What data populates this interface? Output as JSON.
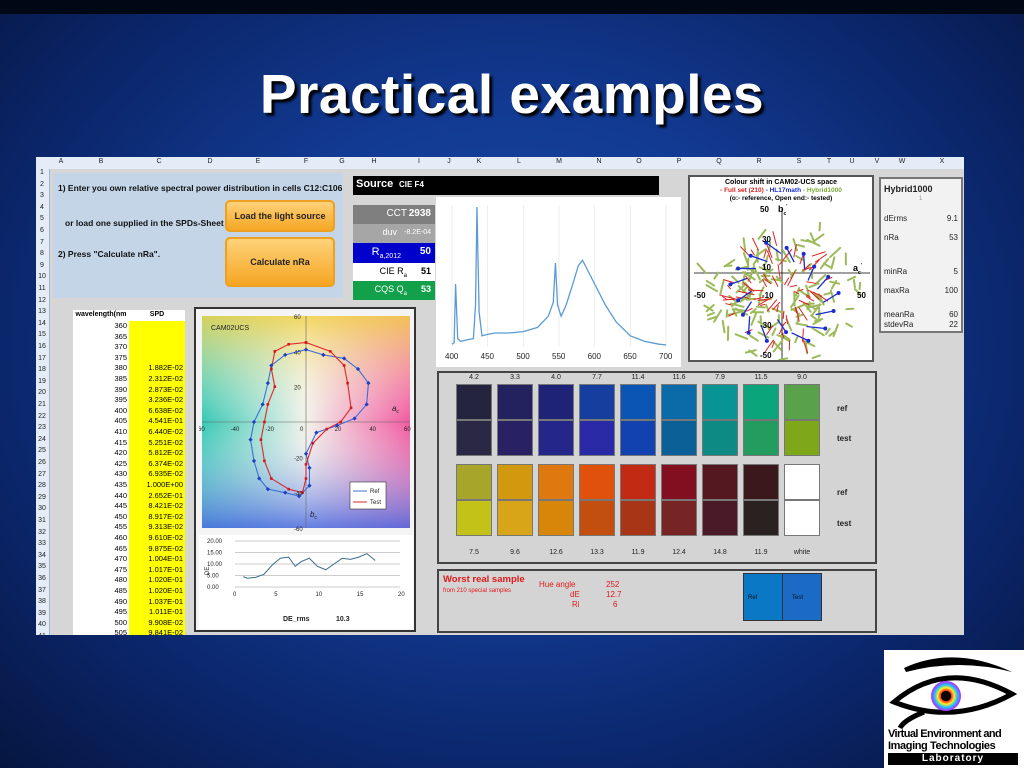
{
  "slide": {
    "title": "Practical examples"
  },
  "columns": [
    "A",
    "B",
    "C",
    "D",
    "E",
    "F",
    "G",
    "H",
    "I",
    "J",
    "K",
    "L",
    "M",
    "N",
    "O",
    "P",
    "Q",
    "R",
    "S",
    "T",
    "U",
    "V",
    "W",
    "X"
  ],
  "rows": [
    "1",
    "2",
    "3",
    "4",
    "5",
    "6",
    "7",
    "8",
    "9",
    "10",
    "11",
    "12",
    "13",
    "14",
    "15",
    "16",
    "17",
    "18",
    "19",
    "20",
    "21",
    "22",
    "23",
    "24",
    "25",
    "26",
    "27",
    "28",
    "29",
    "30",
    "31",
    "32",
    "33",
    "34",
    "35",
    "36",
    "37",
    "38",
    "39",
    "40",
    "41"
  ],
  "instructions": {
    "step1": "1) Enter you own relative spectral power distribution in cells C12:C106",
    "step1b": "or load one supplied in the SPDs-Sheet",
    "step2": "2) Press \"Calculate nRa\".",
    "load_button": "Load the light source",
    "calc_button": "Calculate nRa"
  },
  "source": {
    "header": "Source",
    "name": "CIE F4",
    "cct_label": "CCT",
    "cct_value": "2938",
    "duv_label": "duv",
    "duv_value": "-8.2E-04",
    "ra_label": "R",
    "ra_sub": "a,2012",
    "ra_value": "50",
    "cie_label": "CIE R",
    "cie_sub": "a",
    "cie_value": "51",
    "cqs_label": "CQS Q",
    "cqs_sub": "a",
    "cqs_value": "53"
  },
  "spd_table": {
    "headers": [
      "wavelength(nm",
      "SPD"
    ],
    "rows": [
      [
        "360",
        ""
      ],
      [
        "365",
        ""
      ],
      [
        "370",
        ""
      ],
      [
        "375",
        ""
      ],
      [
        "380",
        "1.882E-02"
      ],
      [
        "385",
        "2.312E-02"
      ],
      [
        "390",
        "2.873E-02"
      ],
      [
        "395",
        "3.236E-02"
      ],
      [
        "400",
        "6.638E-02"
      ],
      [
        "405",
        "4.541E-01"
      ],
      [
        "410",
        "6.440E-02"
      ],
      [
        "415",
        "5.251E-02"
      ],
      [
        "420",
        "5.812E-02"
      ],
      [
        "425",
        "6.374E-02"
      ],
      [
        "430",
        "6.935E-02"
      ],
      [
        "435",
        "1.000E+00"
      ],
      [
        "440",
        "2.652E-01"
      ],
      [
        "445",
        "8.421E-02"
      ],
      [
        "450",
        "8.917E-02"
      ],
      [
        "455",
        "9.313E-02"
      ],
      [
        "460",
        "9.610E-02"
      ],
      [
        "465",
        "9.875E-02"
      ],
      [
        "470",
        "1.004E-01"
      ],
      [
        "475",
        "1.017E-01"
      ],
      [
        "480",
        "1.020E-01"
      ],
      [
        "485",
        "1.020E-01"
      ],
      [
        "490",
        "1.037E-01"
      ],
      [
        "495",
        "1.011E-01"
      ],
      [
        "500",
        "9.908E-02"
      ],
      [
        "505",
        "9.841E-02"
      ]
    ]
  },
  "spd_chart": {
    "x_ticks": [
      "400",
      "450",
      "500",
      "550",
      "600",
      "650",
      "700"
    ]
  },
  "cam_chart": {
    "title": "CAM02UCS",
    "x_ticks": [
      "-60",
      "-40",
      "-20",
      "0",
      "20",
      "40",
      "60"
    ],
    "y_ticks": [
      "60",
      "40",
      "20",
      "-20",
      "-40",
      "-60"
    ],
    "x_label": "a",
    "x_sub": "c",
    "y_label": "b",
    "y_sub": "c",
    "legend": [
      "Ref",
      "Test"
    ]
  },
  "de_chart": {
    "y_label": "DE",
    "y_ticks": [
      "20.00",
      "15.00",
      "10.00",
      "5.00",
      "0.00"
    ],
    "x_ticks": [
      "0",
      "5",
      "10",
      "15",
      "20"
    ],
    "rms_label": "DE_rms",
    "rms_value": "10.3"
  },
  "shift_chart": {
    "title": "Colour shift in CAM02-UCS  space",
    "line2a": "- Full set (210)",
    "line2b": "- HL17math",
    "line2c": "- Hybrid1000",
    "line3": "(o:- reference, Open end:- tested)",
    "ticks_y": [
      "50",
      "30",
      "10",
      "-10",
      "-30",
      "-50"
    ],
    "ticks_x": [
      "-50",
      "50"
    ],
    "x_axis": "a",
    "x_sub": "c",
    "x_sup": "'",
    "y_axis": "b",
    "y_sub": "c",
    "y_sup": "'",
    "label_minus10": "-10"
  },
  "hybrid": {
    "title": "Hybrid1000",
    "sub": "1",
    "rows": [
      {
        "k": "dErms",
        "v": "9.1"
      },
      {
        "k": "nRa",
        "v": "53"
      },
      {
        "k": "minRa",
        "v": "5"
      },
      {
        "k": "maxRa",
        "v": "100"
      },
      {
        "k": "meanRa",
        "v": "60"
      },
      {
        "k": "stdevRa",
        "v": "22"
      }
    ]
  },
  "swatches": {
    "top_nums": [
      "4.2",
      "3.3",
      "4.0",
      "7.7",
      "11.4",
      "11.6",
      "7.9",
      "11.5",
      "9.0"
    ],
    "bottom_nums": [
      "7.5",
      "9.6",
      "12.6",
      "13.3",
      "11.9",
      "12.4",
      "14.8",
      "11.9",
      "white"
    ],
    "top_ref": [
      "#24243f",
      "#23225e",
      "#1e2378",
      "#153e9e",
      "#0b55b4",
      "#0b6aa8",
      "#089494",
      "#0aa57a",
      "#5aa24a"
    ],
    "top_test": [
      "#2a2845",
      "#282264",
      "#25268a",
      "#2a2aa6",
      "#1242b0",
      "#0b6098",
      "#0d8a84",
      "#249c60",
      "#7ea81a"
    ],
    "bot_ref": [
      "#a8a62a",
      "#d2980e",
      "#e07810",
      "#e0520c",
      "#c22a14",
      "#820f20",
      "#561820",
      "#3a181c",
      "#ffffff"
    ],
    "bot_test": [
      "#c2c218",
      "#d8a418",
      "#d8860a",
      "#c24e10",
      "#a83616",
      "#762424",
      "#4a1a28",
      "#2a2220",
      "#ffffff"
    ],
    "labels": {
      "ref": "ref",
      "test": "test"
    }
  },
  "worst": {
    "title": "Worst real sample",
    "sub": "from 210 special samples",
    "hue_label": "Hue angle",
    "hue_value": "252",
    "de_label": "dE",
    "de_value": "12.7",
    "ri_label": "Ri",
    "ri_value": "6",
    "ref_label": "Ref",
    "test_label": "Test",
    "ref_color": "#0b78c6",
    "test_color": "#1a6ac6"
  },
  "logo": {
    "line1": "Virtual Environment and",
    "line2": "Imaging Technologies",
    "line3": "Laboratory"
  }
}
